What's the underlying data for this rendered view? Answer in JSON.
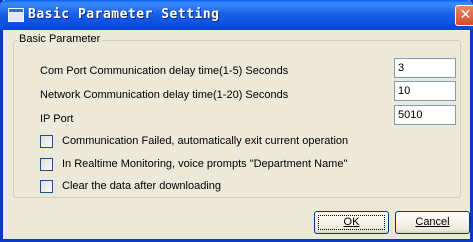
{
  "window": {
    "title": "Basic Parameter Setting"
  },
  "group": {
    "title": "Basic Parameter"
  },
  "fields": {
    "com_delay": {
      "label": "Com Port Communication delay time(1-5) Seconds",
      "value": "3"
    },
    "network_delay": {
      "label": "Network Communication delay time(1-20) Seconds",
      "value": "10"
    },
    "ip_port": {
      "label": "IP Port",
      "value": "5010"
    }
  },
  "checkboxes": [
    {
      "label": "Communication Failed, automatically exit current operation",
      "checked": false
    },
    {
      "label": "In Realtime Monitoring, voice prompts \"Department Name\"",
      "checked": false
    },
    {
      "label": "Clear the data after downloading",
      "checked": false
    }
  ],
  "buttons": {
    "ok_label": "OK",
    "cancel_label": "Cancel"
  },
  "colors": {
    "titlebar": "#0b47cf",
    "dialog_bg": "#ece9d8",
    "close_button": "#d24d24"
  }
}
